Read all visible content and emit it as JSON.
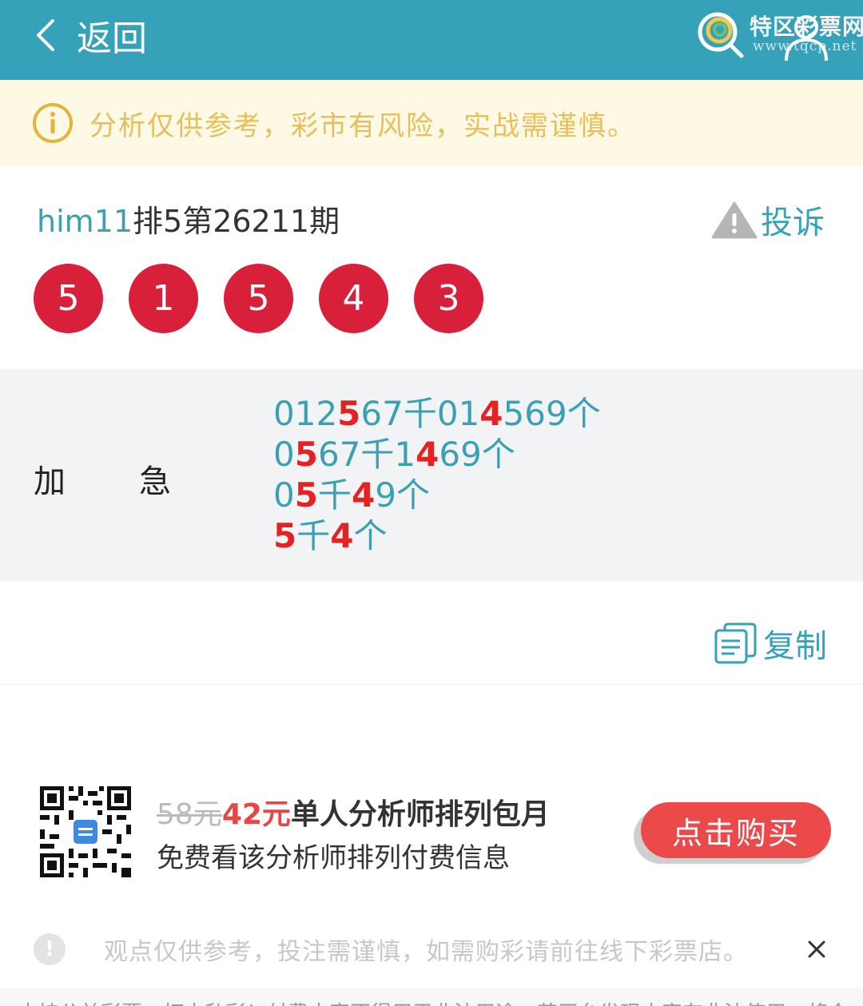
{
  "header": {
    "back_label": "返回",
    "logo_title": "特区彩票网",
    "logo_url": "www.tqcp.net",
    "bg_color": "#35a2ba"
  },
  "notice": {
    "icon": "info-circle-icon",
    "text": "分析仅供参考，彩市有风险，实战需谨慎。",
    "color": "#e6bf5a"
  },
  "issue": {
    "username": "him11",
    "title": "排5第26211期",
    "complain_label": "投诉",
    "balls": [
      "5",
      "1",
      "5",
      "4",
      "3"
    ],
    "ball_color": "#d8203b"
  },
  "prediction": {
    "label_1": "加",
    "label_2": "急",
    "lines": [
      [
        {
          "t": "012",
          "hl": false
        },
        {
          "t": "5",
          "hl": true
        },
        {
          "t": "67千01",
          "hl": false
        },
        {
          "t": "4",
          "hl": true
        },
        {
          "t": "569个",
          "hl": false
        }
      ],
      [
        {
          "t": "0",
          "hl": false
        },
        {
          "t": "5",
          "hl": true
        },
        {
          "t": "67千1",
          "hl": false
        },
        {
          "t": "4",
          "hl": true
        },
        {
          "t": "69个",
          "hl": false
        }
      ],
      [
        {
          "t": "0",
          "hl": false
        },
        {
          "t": "5",
          "hl": true
        },
        {
          "t": "千",
          "hl": false
        },
        {
          "t": "4",
          "hl": true
        },
        {
          "t": "9个",
          "hl": false
        }
      ],
      [
        {
          "t": "5",
          "hl": true
        },
        {
          "t": "千",
          "hl": false
        },
        {
          "t": "4",
          "hl": true
        },
        {
          "t": "个",
          "hl": false
        }
      ]
    ],
    "text_color": "#3ba0b2",
    "highlight_color": "#e52222"
  },
  "copy": {
    "label": "复制"
  },
  "promo": {
    "old_price": "58元",
    "new_price": "42元",
    "title_rest": "单人分析师排列包月",
    "subtitle": "免费看该分析师排列付费信息",
    "buy_label": "点击购买",
    "buy_color": "#ec4a4a"
  },
  "disclaimer": {
    "icon_glyph": "!",
    "text": "观点仅供参考，投注需谨慎，如需购彩请前往线下彩票店。",
    "close_glyph": "×"
  },
  "bottom": {
    "text": "支持公益彩票，打击私彩！付费内容不得用于非法用途，若平台发现内容有非法使用，将会"
  }
}
